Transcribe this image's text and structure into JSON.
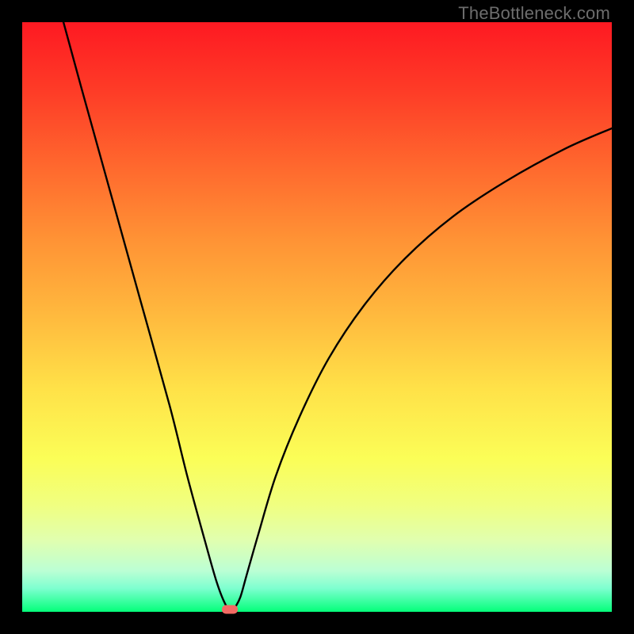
{
  "watermark": "TheBottleneck.com",
  "chart_data": {
    "type": "line",
    "title": "",
    "xlabel": "",
    "ylabel": "",
    "xlim": [
      0,
      100
    ],
    "ylim": [
      0,
      100
    ],
    "grid": false,
    "series": [
      {
        "name": "bottleneck-curve",
        "x": [
          7,
          10,
          15,
          20,
          25,
          28,
          31,
          33,
          34.5,
          35.5,
          36,
          37,
          38,
          40,
          43,
          47,
          52,
          58,
          65,
          73,
          82,
          92,
          100
        ],
        "y": [
          100,
          89,
          71,
          53,
          35,
          23,
          12,
          5,
          1.2,
          0.3,
          0.6,
          2.5,
          6,
          13,
          23,
          33,
          43,
          52,
          60,
          67,
          73,
          78.5,
          82
        ]
      }
    ],
    "marker": {
      "x": 35.2,
      "y": 0.4,
      "color": "#f36a63"
    },
    "background_gradient": [
      "#fe1922",
      "#ffba3e",
      "#fbfe57",
      "#04ff7a"
    ]
  }
}
